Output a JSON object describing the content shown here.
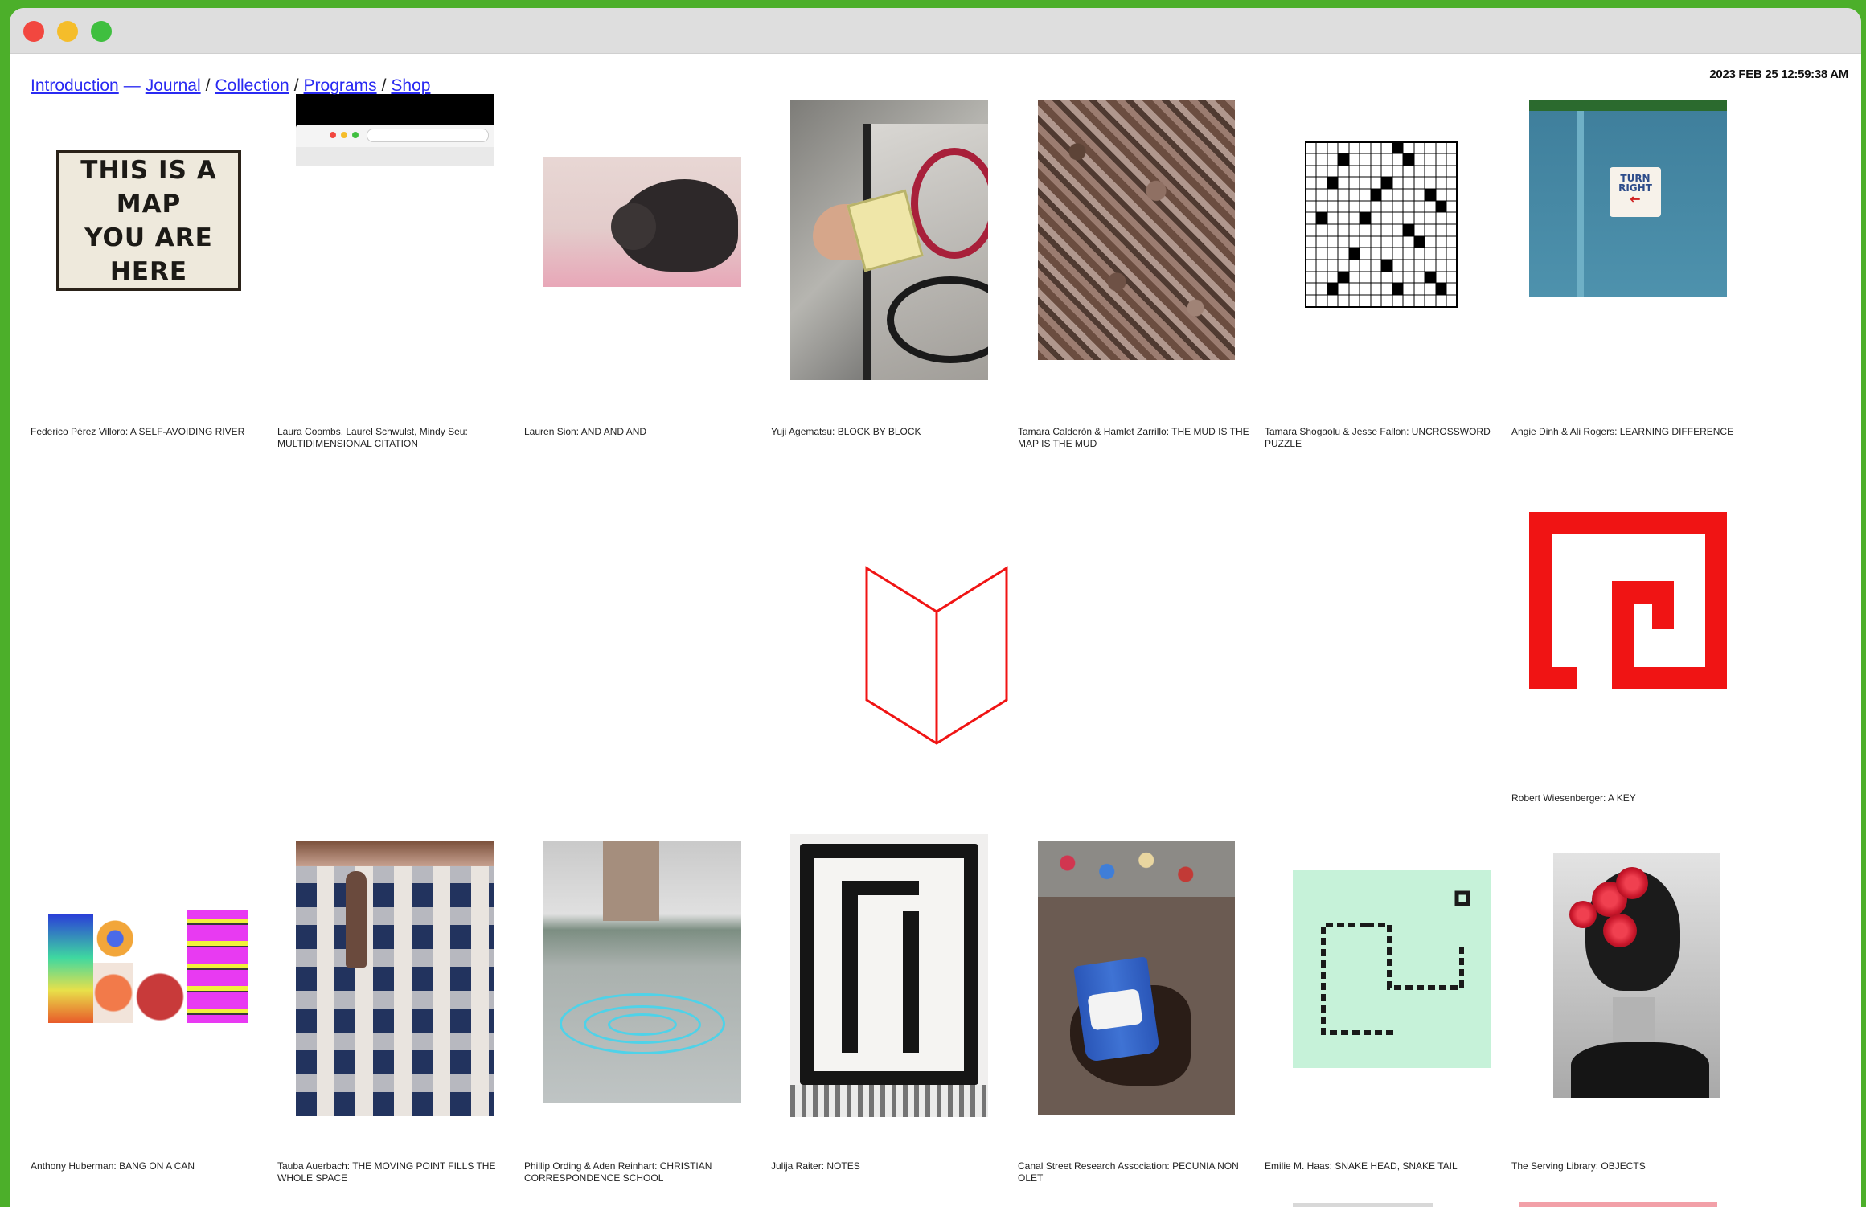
{
  "nav": {
    "introduction": "Introduction",
    "dash": "—",
    "journal": "Journal",
    "slash": "/",
    "collection": "Collection",
    "programs": "Programs",
    "shop": "Shop"
  },
  "datetime": "2023 FEB 25 12:59:38 AM",
  "colors": {
    "frame_green": "#4caf2a",
    "link_blue": "#2a2af2",
    "accent_red": "#f01414"
  },
  "thumb_texts": {
    "map_sign": [
      "THIS IS A",
      "MAP",
      "YOU ARE",
      "HERE"
    ],
    "turn_right": [
      "TURN",
      "RIGHT"
    ]
  },
  "captions": [
    "Federico Pérez Villoro: A SELF-AVOIDING RIVER",
    "Laura Coombs, Laurel Schwulst, Mindy Seu: MULTIDIMENSIONAL CITATION",
    "Lauren Sion: AND AND AND",
    "Yuji Agematsu: BLOCK BY BLOCK",
    "Tamara Calderón & Hamlet Zarrillo: THE MUD IS THE MAP IS THE MUD",
    "Tamara Shogaolu & Jesse Fallon: UNCROSSWORD PUZZLE",
    "Angie Dinh & Ali Rogers: LEARNING DIFFERENCE",
    "Robert Wiesenberger: A KEY",
    "Anthony Huberman: BANG ON A CAN",
    "Tauba Auerbach: THE MOVING POINT FILLS THE WHOLE SPACE",
    "Phillip Ording & Aden Reinhart: CHRISTIAN CORRESPONDENCE SCHOOL",
    "Julija Raiter: NOTES",
    "Canal Street Research Association: PECUNIA NON OLET",
    "Emilie M. Haas: SNAKE HEAD, SNAKE TAIL",
    "The Serving Library: OBJECTS"
  ]
}
